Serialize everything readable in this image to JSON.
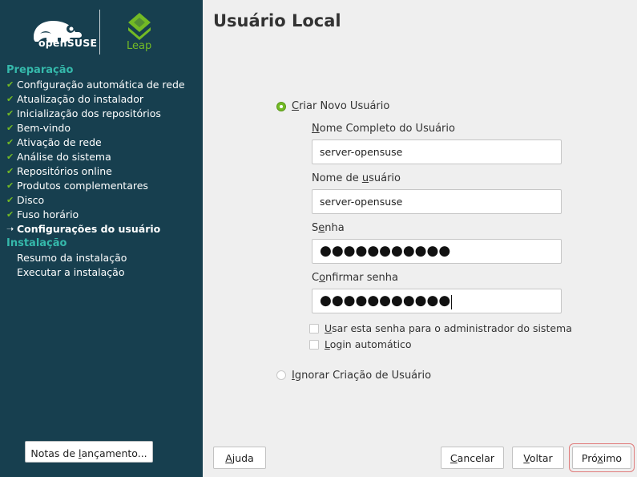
{
  "sidebar": {
    "brand": {
      "opensuse_wordmark": "openSUSE",
      "leap_label": "Leap"
    },
    "sections": [
      {
        "heading": "Preparação",
        "steps": [
          {
            "label": "Configuração automática de rede",
            "status": "done"
          },
          {
            "label": "Atualização do instalador",
            "status": "done"
          },
          {
            "label": "Inicialização dos repositórios",
            "status": "done"
          },
          {
            "label": "Bem-vindo",
            "status": "done"
          },
          {
            "label": "Ativação de rede",
            "status": "done"
          },
          {
            "label": "Análise do sistema",
            "status": "done"
          },
          {
            "label": "Repositórios online",
            "status": "done"
          },
          {
            "label": "Produtos complementares",
            "status": "done"
          },
          {
            "label": "Disco",
            "status": "done"
          },
          {
            "label": "Fuso horário",
            "status": "done"
          },
          {
            "label": "Configurações do usuário",
            "status": "current"
          }
        ]
      },
      {
        "heading": "Instalação",
        "steps": [
          {
            "label": "Resumo da instalação",
            "status": "pending"
          },
          {
            "label": "Executar a instalação",
            "status": "pending"
          }
        ]
      }
    ],
    "release_notes_button": {
      "pre": "Notas de ",
      "key": "l",
      "post": "ançamento..."
    },
    "icons": {
      "done": "check-icon",
      "current": "arrow-right-icon"
    },
    "colors": {
      "background": "#173f4f",
      "heading": "#35b9ab",
      "check": "#73ba25",
      "leap": "#73ba25"
    }
  },
  "main": {
    "title": "Usuário Local",
    "create_user": {
      "selected": true,
      "label": {
        "key": "C",
        "rest": "riar Novo Usuário"
      },
      "full_name": {
        "label": {
          "key": "N",
          "rest": "ome Completo do Usuário"
        },
        "value": "server-opensuse"
      },
      "username": {
        "label": {
          "pre": "Nome de ",
          "key": "u",
          "post": "suário"
        },
        "value": "server-opensuse"
      },
      "password": {
        "label": {
          "pre": "S",
          "key": "e",
          "post": "nha"
        },
        "value": "●●●●●●●●●●●"
      },
      "confirm_password": {
        "label": {
          "pre": "C",
          "key": "o",
          "post": "nfirmar senha"
        },
        "value": "●●●●●●●●●●●"
      },
      "use_for_admin": {
        "checked": false,
        "label": {
          "key": "U",
          "rest": "sar esta senha para o administrador do sistema"
        }
      },
      "auto_login": {
        "checked": false,
        "label": {
          "key": "L",
          "rest": "ogin automático"
        }
      }
    },
    "skip_user": {
      "selected": false,
      "label": {
        "key": "I",
        "rest": "gnorar Criação de Usuário"
      }
    }
  },
  "footer": {
    "help": {
      "key": "A",
      "rest": "juda"
    },
    "cancel": {
      "key": "C",
      "rest": "ancelar"
    },
    "back": {
      "key": "V",
      "rest": "oltar"
    },
    "next": {
      "pre": "Pró",
      "key": "x",
      "post": "imo"
    }
  },
  "accent_color": "#73ba25"
}
